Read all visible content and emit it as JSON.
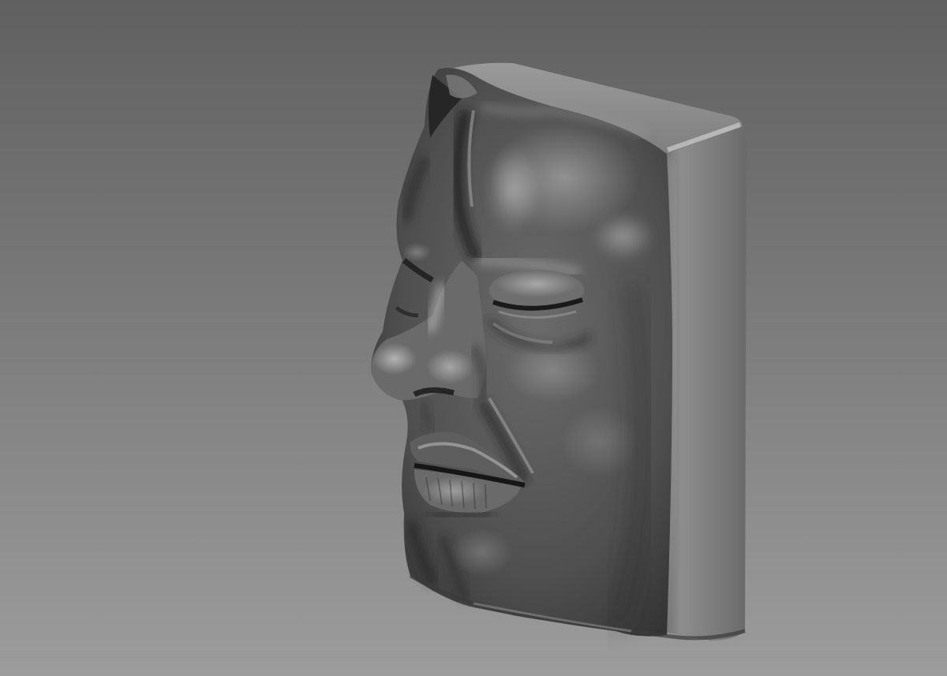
{
  "scene": {
    "background": {
      "top_color": "#606060",
      "bottom_color": "#9c9c9c"
    },
    "material": {
      "base_color": "#5a5a5a",
      "highlight_color": "#bdbdbd",
      "shadow_color": "#262626"
    }
  }
}
